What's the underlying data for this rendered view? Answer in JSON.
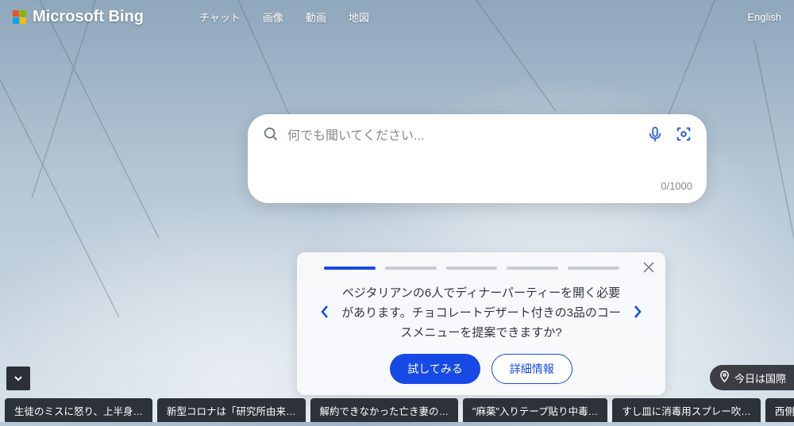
{
  "header": {
    "brand": "Microsoft Bing",
    "nav": {
      "chat": "チャット",
      "images": "画像",
      "video": "動画",
      "maps": "地図"
    },
    "language": "English"
  },
  "search": {
    "placeholder": "何でも聞いてください...",
    "char_count": "0/1000"
  },
  "suggestion": {
    "text": "ベジタリアンの6人でディナーパーティーを開く必要があります。チョコレートデザート付きの3品のコースメニューを提案できますか?",
    "try_label": "試してみる",
    "more_label": "詳細情報",
    "slides_total": 5,
    "active_slide": 1
  },
  "location": {
    "label": "今日は国際"
  },
  "news": {
    "items": [
      "生徒のミスに怒り、上半身…",
      "新型コロナは「研究所由来…",
      "解約できなかった亡き妻の…",
      "\"麻薬\"入りテープ貼り中毒…",
      "すし皿に消毒用スプレー吹…",
      "西側、"
    ]
  }
}
